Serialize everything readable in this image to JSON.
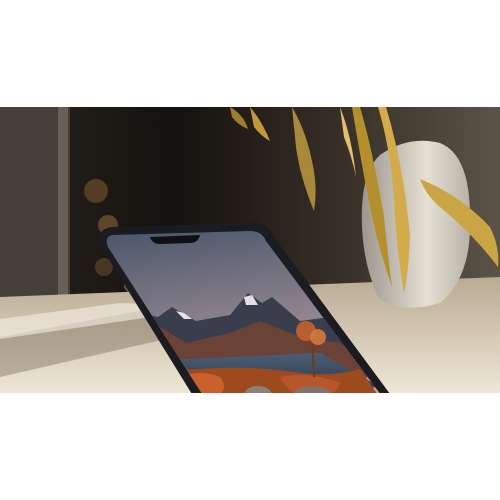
{
  "image": {
    "subject": "smartphone-on-table-with-mountain-lake-wallpaper",
    "colors": {
      "background_dark": "#1a1510",
      "table": "#d8cbb4",
      "plant_leaf": "#c7a03a",
      "vase": "#e9e3d7",
      "phone_frame": "#1b1c22",
      "sky_top": "#4c5a72",
      "sky_bottom": "#c9a99b",
      "mountain": "#3a3d4c",
      "grass": "#b6531f",
      "water": "#2f3a4a"
    }
  },
  "phone_screen": {
    "buttons": [
      {
        "name": "left-control",
        "icon": "circle-dot-icon"
      },
      {
        "name": "center-control",
        "icon": "circle-icon"
      },
      {
        "name": "right-control",
        "icon": "camera-icon"
      }
    ]
  }
}
